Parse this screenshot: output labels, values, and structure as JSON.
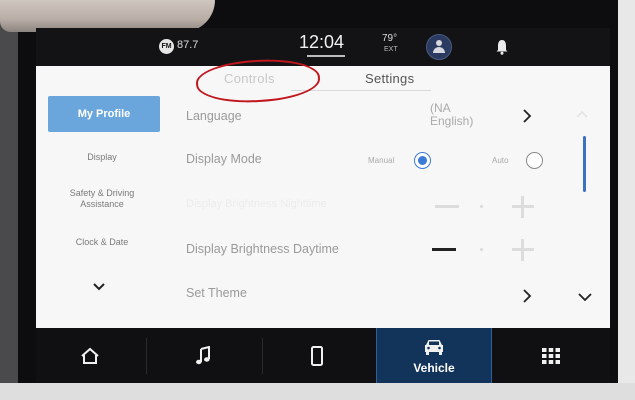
{
  "status_bar": {
    "radio_badge": "FM",
    "radio_frequency": "87.7",
    "clock": "12:04",
    "temperature": "79°",
    "temperature_label": "EXT",
    "icons": [
      "profile-icon",
      "bell-icon"
    ]
  },
  "tabs": [
    {
      "label": "Controls",
      "selected": false
    },
    {
      "label": "Settings",
      "selected": true
    }
  ],
  "sidebar": {
    "items": [
      {
        "label": "My Profile",
        "selected": true
      },
      {
        "label": "Display",
        "selected": false
      },
      {
        "label": "Safety & Driving Assistance",
        "selected": false
      },
      {
        "label": "Clock & Date",
        "selected": false
      }
    ],
    "more_icon": "chevron-down-icon"
  },
  "settings": {
    "language": {
      "label": "Language",
      "value": "(NA English)"
    },
    "display_mode": {
      "label": "Display Mode",
      "options": [
        {
          "label": "Manual",
          "selected": true
        },
        {
          "label": "Auto",
          "selected": false
        }
      ]
    },
    "brightness_nighttime": {
      "label": "Display Brightness Nighttime"
    },
    "brightness_daytime": {
      "label": "Display Brightness Daytime"
    },
    "set_theme": {
      "label": "Set Theme"
    }
  },
  "nav": {
    "items": [
      {
        "icon": "home-icon",
        "label": ""
      },
      {
        "icon": "music-note-icon",
        "label": ""
      },
      {
        "icon": "phone-icon",
        "label": ""
      },
      {
        "icon": "vehicle-icon",
        "label": "Vehicle",
        "active": true
      },
      {
        "icon": "app-grid-icon",
        "label": ""
      }
    ]
  },
  "colors": {
    "accent": "#3a7bd5",
    "selected_tile": "#6aa6dc",
    "nav_active": "#12335a",
    "annotation": "#c0161e"
  }
}
